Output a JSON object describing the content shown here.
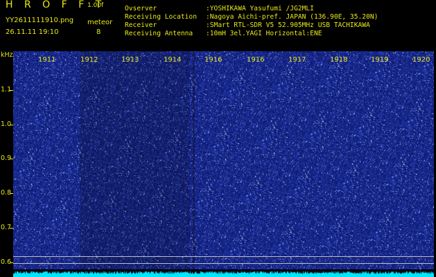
{
  "header": {
    "logo": "H R O F F T",
    "version": "1.00f",
    "filename": "YY2611111910.png",
    "timestamp": "26.11.11 19:10",
    "meteor_label": "meteor",
    "meteor_count": "8"
  },
  "info": [
    {
      "key": "Ovserver",
      "value": ":YOSHIKAWA Yasufumi /JG2MLI"
    },
    {
      "key": "Receiving Location",
      "value": ":Nagoya Aichi-pref. JAPAN (136.90E, 35.20N)"
    },
    {
      "key": "Receiver",
      "value": ":SMart RTL-SDR V5 52.905MHz USB TACHIKAWA"
    },
    {
      "key": "Receiving Antenna",
      "value": ":10mH 3el.YAGI Horizontal:ENE"
    }
  ],
  "axis": {
    "y_unit": "kHz",
    "y_ticks": [
      "1.1",
      "1.0",
      "0.9",
      "0.8",
      "0.7",
      "0.6"
    ],
    "x_ticks": [
      "1911",
      "1912",
      "1913",
      "1914",
      "1916",
      "1916",
      "1917",
      "1918",
      "1919",
      "1920"
    ]
  },
  "colors": {
    "background": "#000000",
    "text": "#e8e81a",
    "waterfall_base": "#1c2a9c",
    "noise_band": "#00e5ff"
  }
}
